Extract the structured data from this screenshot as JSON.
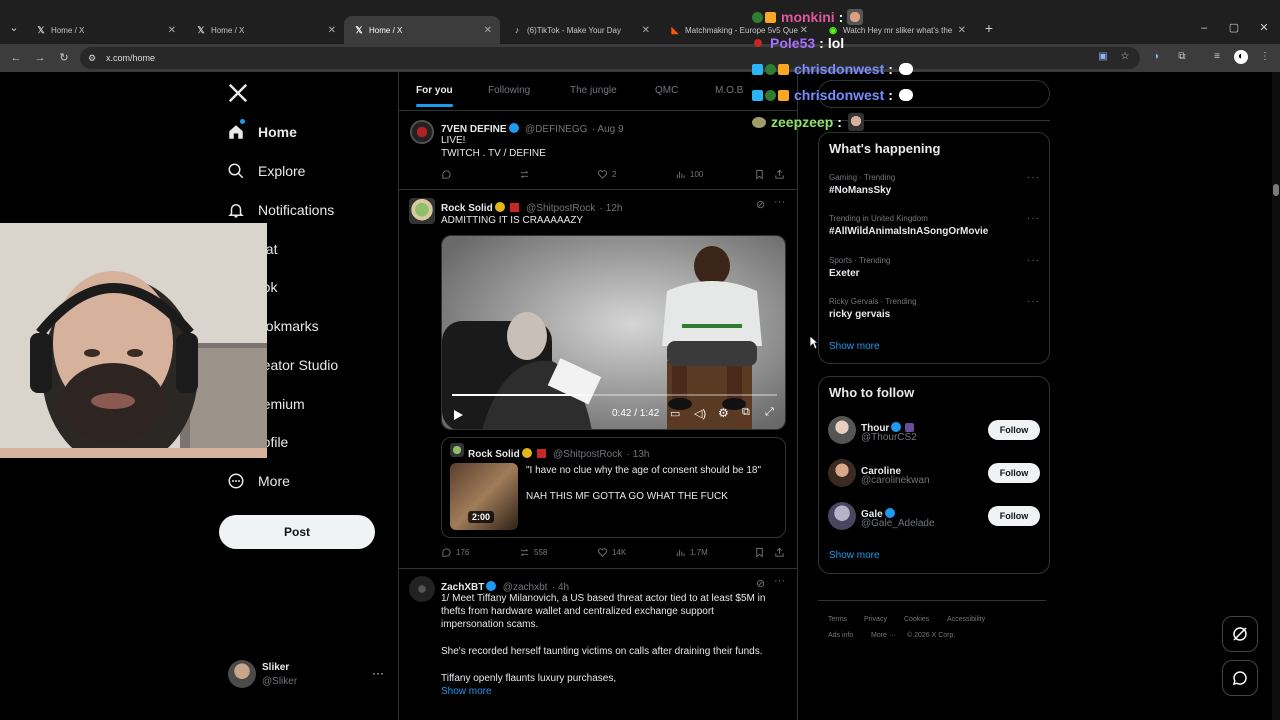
{
  "browser": {
    "tabs": [
      {
        "title": "Home / X",
        "icon": "x-logo-icon"
      },
      {
        "title": "Home / X",
        "icon": "x-logo-icon"
      },
      {
        "title": "Home / X",
        "icon": "x-logo-icon",
        "active": true
      },
      {
        "title": "(6)TikTok - Make Your Day",
        "icon": "tiktok-icon"
      },
      {
        "title": "Matchmaking - Europe 5v5 Que",
        "icon": "faceit-icon"
      },
      {
        "title": "Watch Hey mr sliker what's the",
        "icon": "kick-icon"
      }
    ],
    "url": "x.com/home"
  },
  "sidebar": {
    "items": [
      {
        "label": "Home",
        "icon": "home-icon"
      },
      {
        "label": "Explore",
        "icon": "search-icon"
      },
      {
        "label": "Notifications",
        "icon": "bell-icon"
      },
      {
        "label": "hat",
        "icon": "chat-icon"
      },
      {
        "label": "rok",
        "icon": "grok-icon"
      },
      {
        "label": "ookmarks",
        "icon": "bookmark-icon"
      },
      {
        "label": "reator Studio",
        "icon": "studio-icon"
      },
      {
        "label": "remium",
        "icon": "premium-icon"
      },
      {
        "label": "rofile",
        "icon": "profile-icon"
      },
      {
        "label": "More",
        "icon": "more-circle-icon"
      }
    ],
    "post_label": "Post",
    "account": {
      "name": "Sliker",
      "handle": "@Sliker"
    }
  },
  "feed": {
    "tabs": [
      "For you",
      "Following",
      "The jungle",
      "QMC",
      "M.O.B"
    ],
    "posts": [
      {
        "name": "7VEN DEFINE",
        "handle": "@DEFINEGG",
        "time": "· Aug 9",
        "text_lines": [
          "LIVE!",
          "TWITCH . TV / DEFINE"
        ],
        "replies": "",
        "reposts": "",
        "likes": "2",
        "views": "100"
      },
      {
        "name": "Rock Solid",
        "handle": "@ShitpostRock",
        "time": "· 12h",
        "text_lines": [
          "ADMITTING IT IS CRAAAAAZY"
        ],
        "video_time": "0:42 / 1:42",
        "quote": {
          "name": "Rock Solid",
          "handle": "@ShitpostRock",
          "time": "· 13h",
          "line1": "\"I have no clue why the age of consent should be 18\"",
          "line2": "NAH THIS MF GOTTA GO WHAT THE FUCK",
          "duration": "2:00"
        },
        "replies": "176",
        "reposts": "558",
        "likes": "14K",
        "views": "1.7M"
      },
      {
        "name": "ZachXBT",
        "handle": "@zachxbt",
        "time": "· 4h",
        "text_lines": [
          "1/ Meet Tiffany Milanovich, a US based threat actor tied to at least $5M in",
          "thefts from hardware wallet and centralized exchange support",
          "impersonation scams."
        ],
        "text2": "She's recorded herself taunting victims on calls after draining their funds.",
        "text3": "Tiffany openly flaunts luxury purchases,",
        "show_more": "Show more"
      }
    ]
  },
  "right": {
    "happening_title": "What's happening",
    "trends": [
      {
        "meta": "Gaming · Trending",
        "title": "#NoMansSky"
      },
      {
        "meta": "Trending in United Kingdom",
        "title": "#AllWildAnimalsInASongOrMovie"
      },
      {
        "meta": "Sports · Trending",
        "title": "Exeter"
      },
      {
        "meta": "Ricky Gervais · Trending",
        "title": "ricky gervais"
      }
    ],
    "show_more": "Show more",
    "who_to_follow_title": "Who to follow",
    "follow": [
      {
        "name": "Thour",
        "handle": "@ThourCS2"
      },
      {
        "name": "Caroline",
        "handle": "@carolinekwan"
      },
      {
        "name": "Gale",
        "handle": "@Gale_Adelade"
      }
    ],
    "follow_label": "Follow",
    "show_more2": "Show more",
    "footer": [
      "Terms",
      "Privacy",
      "Cookies",
      "Accessibility",
      "Ads info",
      "More ···",
      "© 2026 X Corp."
    ]
  },
  "chat": [
    {
      "user": "monkini",
      "msg": "",
      "color": "#e0569d"
    },
    {
      "user": "Pole53",
      "msg": "lol",
      "color": "#a970ff"
    },
    {
      "user": "chrisdonwest",
      "msg": "",
      "color": "#7b8cff"
    },
    {
      "user": "chrisdonwest",
      "msg": "",
      "color": "#7b8cff"
    },
    {
      "user": "zeepzeep",
      "msg": "",
      "color": "#8ee36b"
    }
  ],
  "colors": {
    "accent": "#1d9bf0",
    "bg": "#000000",
    "border": "#2f3336"
  }
}
